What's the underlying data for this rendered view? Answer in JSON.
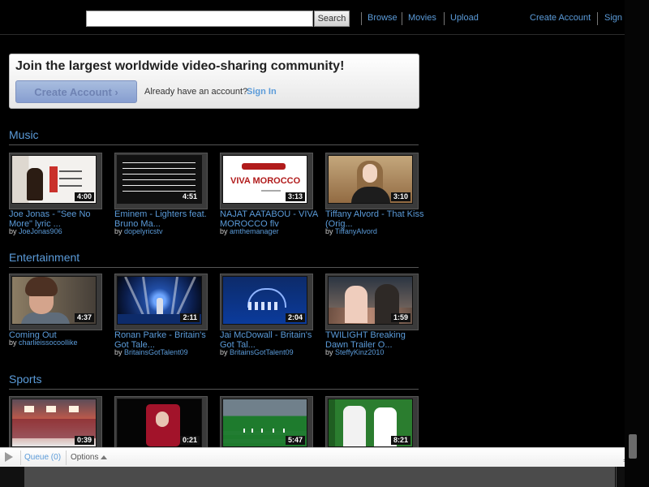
{
  "header": {
    "search": {
      "placeholder": "",
      "button": "Search"
    },
    "nav": [
      "Browse",
      "Movies",
      "Upload"
    ],
    "auth": {
      "create_account": "Create Account",
      "sign_in": "Sign In"
    }
  },
  "promo": {
    "title": "Join the largest worldwide video-sharing community!",
    "cta": "Create Account ›",
    "have_account": "Already have an account?",
    "sign_in": "Sign In"
  },
  "sections": [
    {
      "title": "Music",
      "videos": [
        {
          "title": "Joe Jonas - \"See No More\" lyric ...",
          "by": "JoeJonas906",
          "duration": "4:00"
        },
        {
          "title": "Eminem - Lighters feat. Bruno Ma...",
          "by": "dopelyricstv",
          "duration": "4:51"
        },
        {
          "title": "NAJAT AATABOU - VIVA MOROCCO flv",
          "by": "amthemanager",
          "duration": "3:13"
        },
        {
          "title": "Tiffany Alvord - That Kiss (Orig...",
          "by": "TiffanyAlvord",
          "duration": "3:10"
        }
      ]
    },
    {
      "title": "Entertainment",
      "videos": [
        {
          "title": "Coming Out",
          "by": "charlieissocoollike",
          "duration": "4:37"
        },
        {
          "title": "Ronan Parke - Britain's Got Tale...",
          "by": "BritainsGotTalent09",
          "duration": "2:11"
        },
        {
          "title": "Jai McDowall - Britain's Got Tal...",
          "by": "BritainsGotTalent09",
          "duration": "2:04"
        },
        {
          "title": "TWILIGHT Breaking Dawn Trailer O...",
          "by": "SteffyKinz2010",
          "duration": "1:59"
        }
      ]
    },
    {
      "title": "Sports",
      "videos": [
        {
          "duration": "0:39"
        },
        {
          "duration": "0:21"
        },
        {
          "duration": "5:47"
        },
        {
          "duration": "8:21"
        }
      ]
    }
  ],
  "queue_bar": {
    "queue_label": "Queue (0)",
    "options_label": "Options"
  },
  "by_label": "by"
}
